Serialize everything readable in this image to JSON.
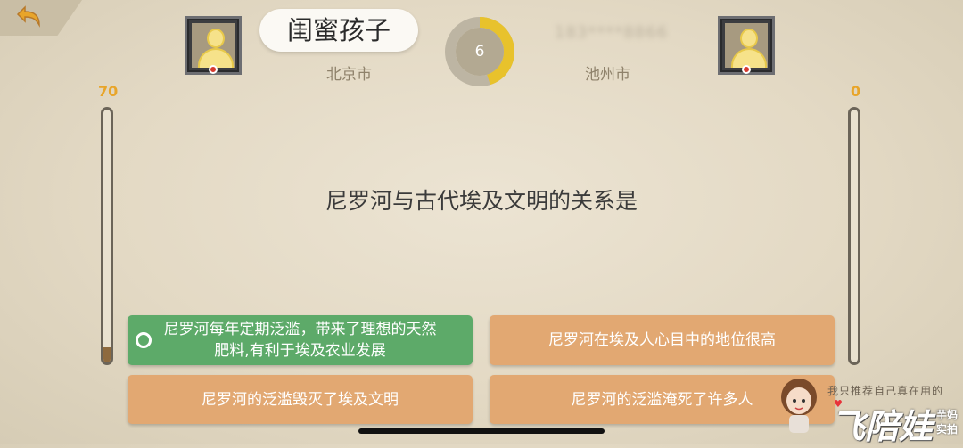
{
  "header": {
    "player_name": "闺蜜孩子",
    "left_city": "北京市",
    "right_city": "池州市",
    "right_name": "183****8866",
    "timer_value": "6",
    "timer_progress": 0.45,
    "accent_color": "#e8c22c"
  },
  "scores": {
    "left": "70",
    "right": "0",
    "left_fill": 0.06,
    "right_fill": 0.0,
    "score_color": "#e8a52a"
  },
  "question": {
    "text": "尼罗河与古代埃及文明的关系是"
  },
  "options": [
    {
      "text": "尼罗河每年定期泛滥，带来了理想的天然肥料,有利于埃及农业发展",
      "state": "selected-correct"
    },
    {
      "text": "尼罗河在埃及人心目中的地位很高",
      "state": "normal"
    },
    {
      "text": "尼罗河的泛滥毁灭了埃及文明",
      "state": "normal"
    },
    {
      "text": "尼罗河的泛滥淹死了许多人",
      "state": "normal"
    }
  ],
  "colors": {
    "option_default": "#e2a872",
    "option_correct": "#5daa69"
  },
  "icons": {
    "back": "back-arrow-icon",
    "avatar": "default-avatar-icon",
    "selected": "ring-icon"
  },
  "watermark": {
    "tagline": "我只推荐自己真在用的",
    "logo": "飞陪娃",
    "side_line1": "芋妈",
    "side_line2": "实拍"
  }
}
